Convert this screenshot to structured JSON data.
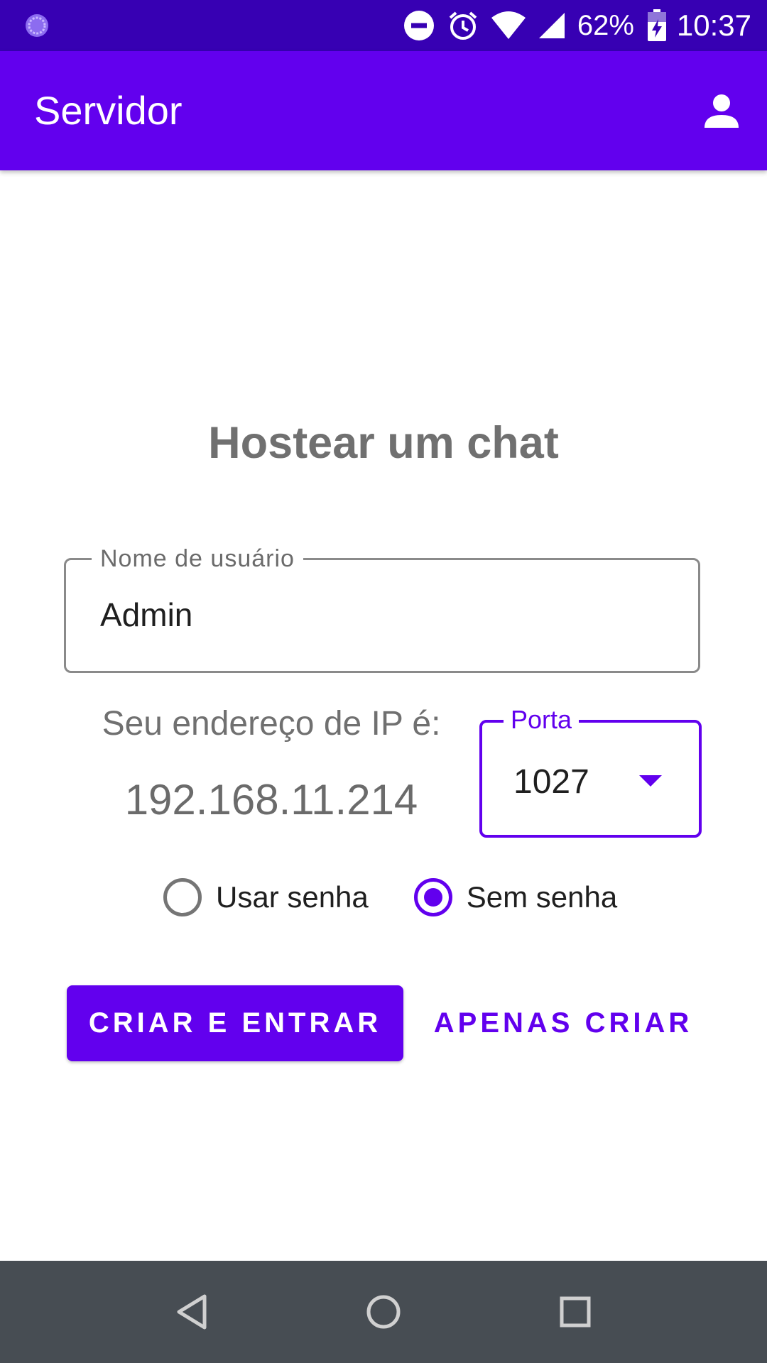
{
  "status_bar": {
    "battery_percent": "62%",
    "time": "10:37",
    "icons": [
      "app-notification-icon",
      "do-not-disturb-icon",
      "alarm-icon",
      "wifi-icon",
      "signal-icon",
      "battery-charging-icon"
    ]
  },
  "app_bar": {
    "title": "Servidor",
    "account_icon": "account-icon"
  },
  "main": {
    "heading": "Hostear um chat",
    "username": {
      "label": "Nome de usuário",
      "value": "Admin"
    },
    "ip": {
      "label": "Seu endereço de IP é:",
      "value": "192.168.11.214"
    },
    "port": {
      "label": "Porta",
      "value": "1027"
    },
    "password_options": [
      {
        "label": "Usar senha",
        "selected": false
      },
      {
        "label": "Sem senha",
        "selected": true
      }
    ],
    "buttons": {
      "create_and_join": "CRIAR E ENTRAR",
      "create_only": "APENAS CRIAR"
    }
  },
  "nav_bar": {
    "icons": [
      "back-icon",
      "home-icon",
      "recents-icon"
    ]
  },
  "colors": {
    "primary": "#6200ee",
    "primary_dark": "#3700b3",
    "nav_bar": "#474d53"
  }
}
